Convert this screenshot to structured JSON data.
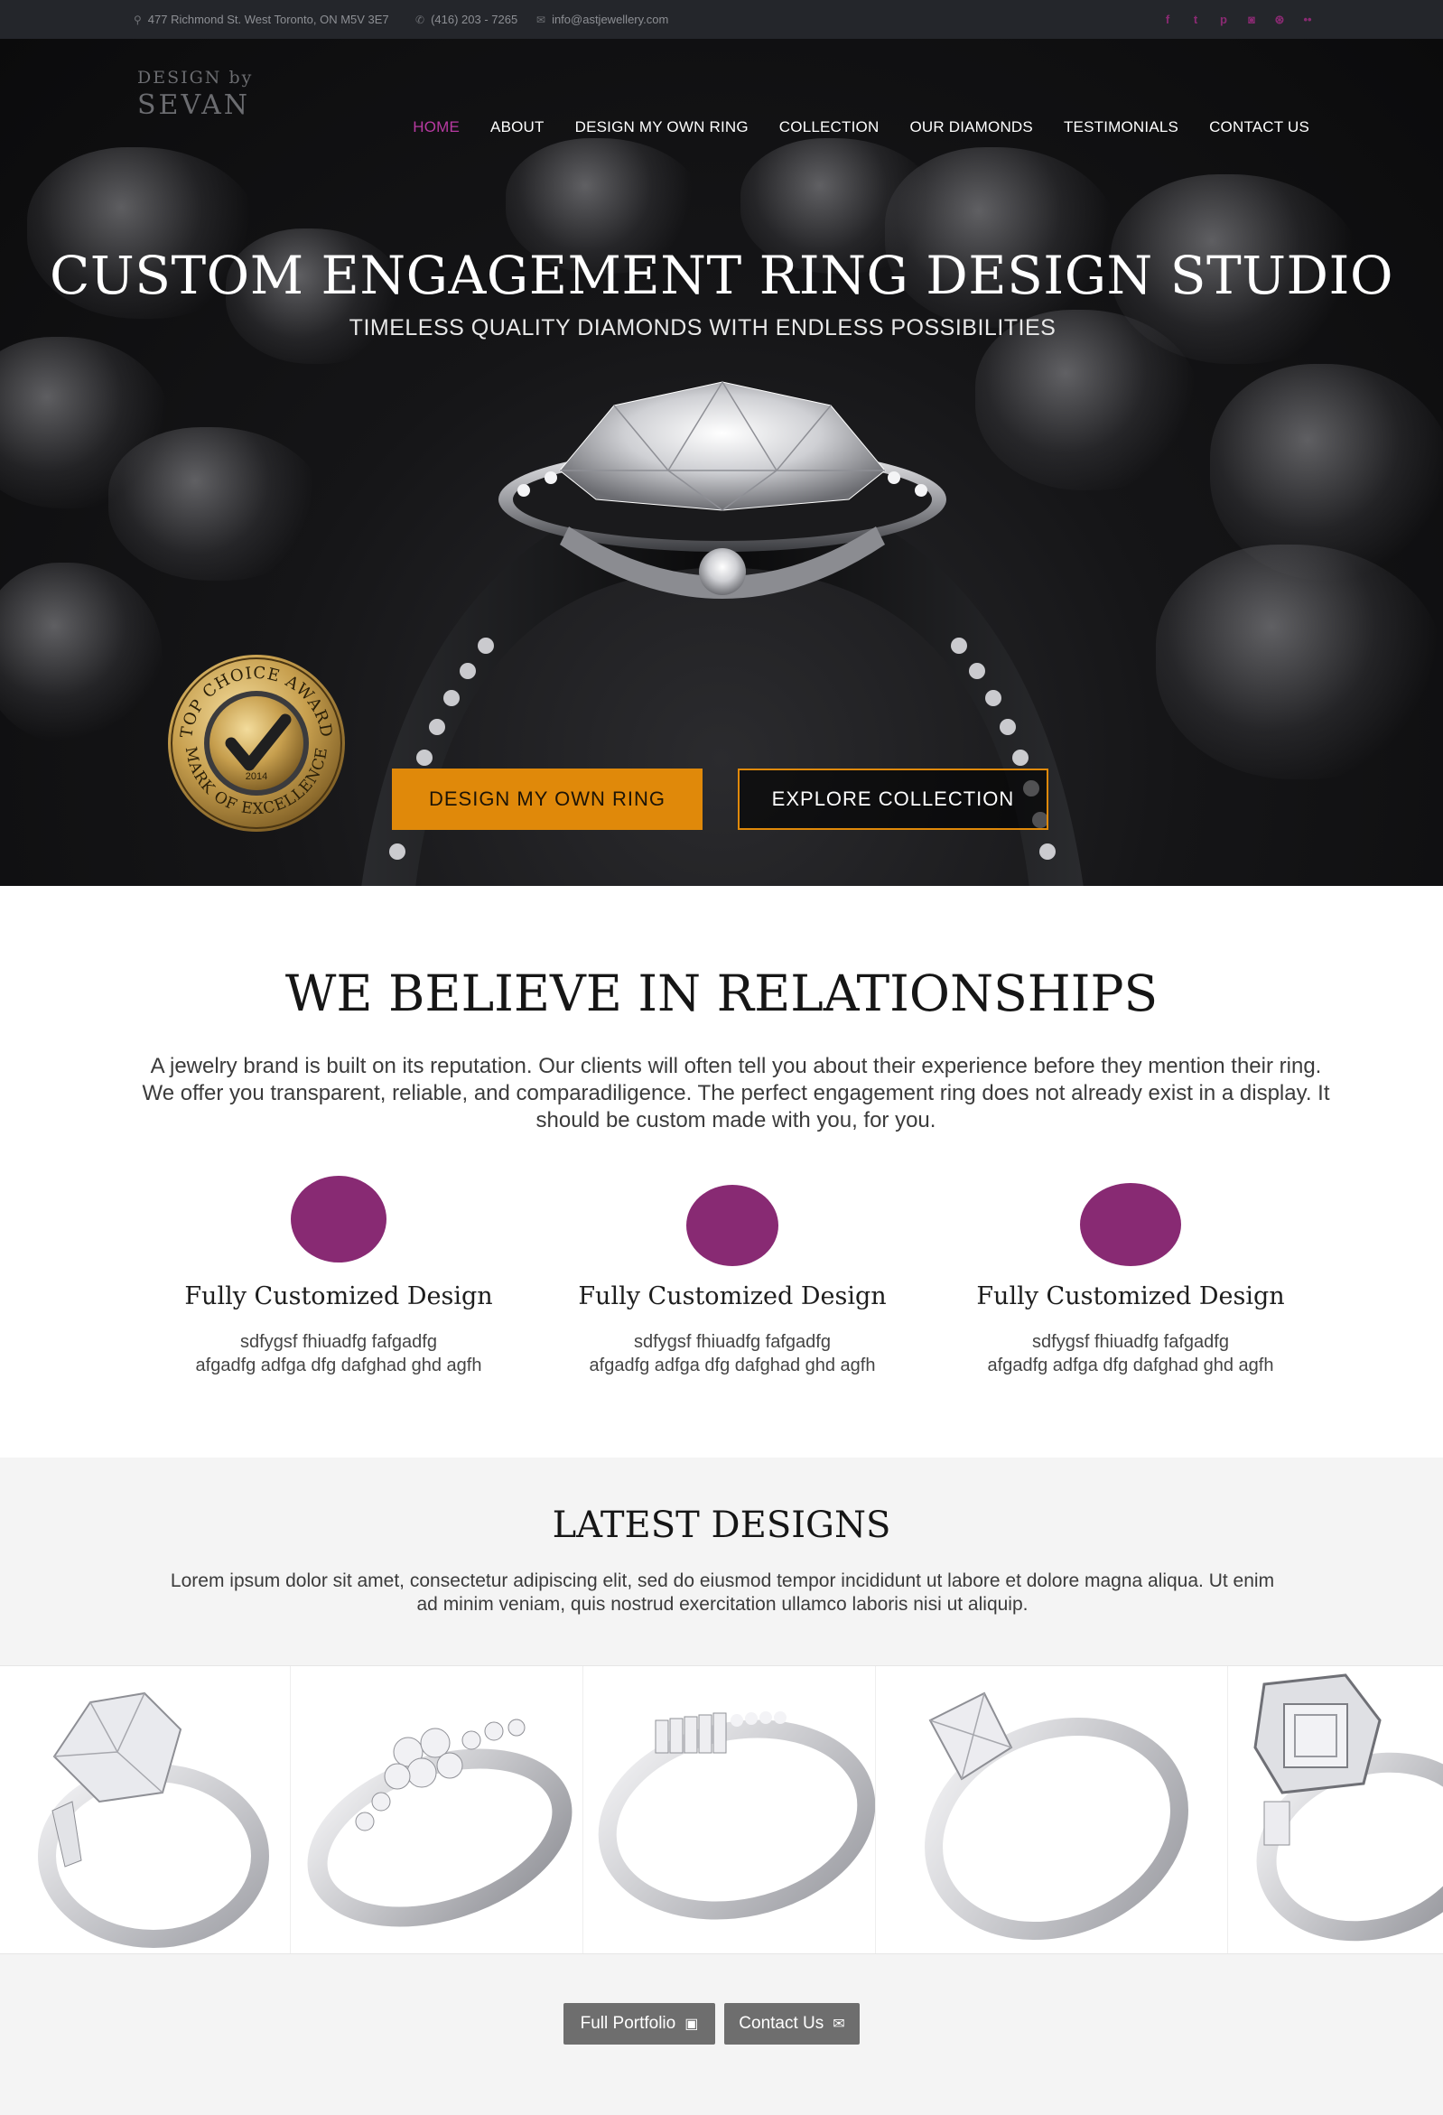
{
  "topbar": {
    "address": "477 Richmond St. West Toronto, ON M5V 3E7",
    "phone": "(416) 203 - 7265",
    "email": "info@astjewellery.com",
    "social": [
      {
        "icon": "facebook-icon",
        "glyph": "f"
      },
      {
        "icon": "twitter-icon",
        "glyph": "t"
      },
      {
        "icon": "pinterest-icon",
        "glyph": "p"
      },
      {
        "icon": "instagram-icon",
        "glyph": "◙"
      },
      {
        "icon": "dribbble-icon",
        "glyph": "⊛"
      },
      {
        "icon": "flickr-icon",
        "glyph": "••"
      }
    ]
  },
  "logo": {
    "line1": "DESIGN by",
    "line2": "SEVAN"
  },
  "nav": {
    "items": [
      "HOME",
      "ABOUT",
      "DESIGN MY OWN RING",
      "COLLECTION",
      "OUR DIAMONDS",
      "TESTIMONIALS",
      "CONTACT US"
    ],
    "active": "HOME"
  },
  "hero": {
    "title": "CUSTOM ENGAGEMENT RING DESIGN STUDIO",
    "subtitle": "TIMELESS QUALITY DIAMONDS WITH ENDLESS POSSIBILITIES",
    "primary_button": "DESIGN MY OWN RING",
    "secondary_button": "EXPLORE COLLECTION",
    "badge": {
      "top": "TOP CHOICE AWARD",
      "bottom": "MARK OF EXCELLENCE",
      "year": "2014"
    }
  },
  "believe": {
    "title": "WE BELIEVE IN RELATIONSHIPS",
    "text": "A jewelry brand is built on its reputation. Our clients will often tell you about their experience before they mention their ring.  We offer you transparent, reliable, and comparadiligence.  The perfect engagement ring does not already exist in a display. It should be custom made with you, for you.",
    "features": [
      {
        "title": "Fully Customized Design",
        "line1": "sdfygsf  fhiuadfg fafgadfg",
        "line2": "afgadfg adfga dfg dafghad ghd agfh"
      },
      {
        "title": "Fully Customized Design",
        "line1": "sdfygsf  fhiuadfg fafgadfg",
        "line2": "afgadfg adfga dfg dafghad ghd agfh"
      },
      {
        "title": "Fully Customized Design",
        "line1": "sdfygsf  fhiuadfg fafgadfg",
        "line2": "afgadfg adfga dfg dafghad ghd agfh"
      }
    ],
    "accent_color": "#882a73"
  },
  "latest": {
    "title": "LATEST DESIGNS",
    "text": "Lorem ipsum dolor sit amet, consectetur adipiscing elit, sed do eiusmod tempor incididunt ut labore et dolore magna aliqua. Ut enim ad minim veniam, quis nostrud exercitation ullamco laboris nisi ut aliquip.",
    "portfolio_button": "Full Portfolio",
    "contact_button": "Contact Us"
  },
  "colors": {
    "orange": "#e0890a",
    "purple": "#882a73",
    "nav_active": "#b83aa2",
    "topbar": "#24262b"
  }
}
